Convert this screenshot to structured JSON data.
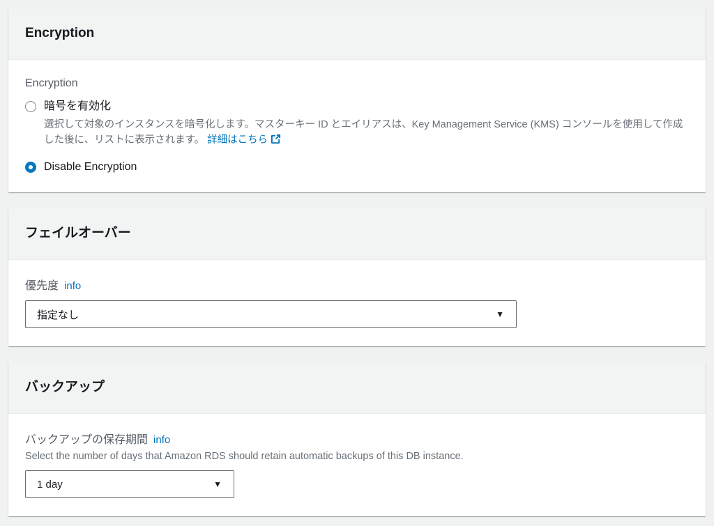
{
  "colors": {
    "accent_blue": "#0073bb",
    "selected_radio_blue": "#0877bd",
    "header_background": "#f2f3f3",
    "page_background": "#f0f1f1"
  },
  "icons": {
    "caret_down": "▼",
    "external_link": "external-link"
  },
  "cards": {
    "encryption": {
      "title": "Encryption",
      "field_label": "Encryption",
      "option_enable": {
        "label": "暗号を有効化",
        "selected": false,
        "description": "選択して対象のインスタンスを暗号化します。マスターキー ID とエイリアスは、Key Management Service (KMS) コンソールを使用して作成した後に、リストに表示されます。",
        "link_label": "詳細はこちら"
      },
      "option_disable": {
        "label": "Disable Encryption",
        "selected": true
      }
    },
    "failover": {
      "title": "フェイルオーバー",
      "field_label": "優先度",
      "info_label": "info",
      "select_value": "指定なし"
    },
    "backup": {
      "title": "バックアップ",
      "field_label": "バックアップの保存期間",
      "info_label": "info",
      "description": "Select the number of days that Amazon RDS should retain automatic backups of this DB instance.",
      "select_value": "1 day"
    }
  }
}
